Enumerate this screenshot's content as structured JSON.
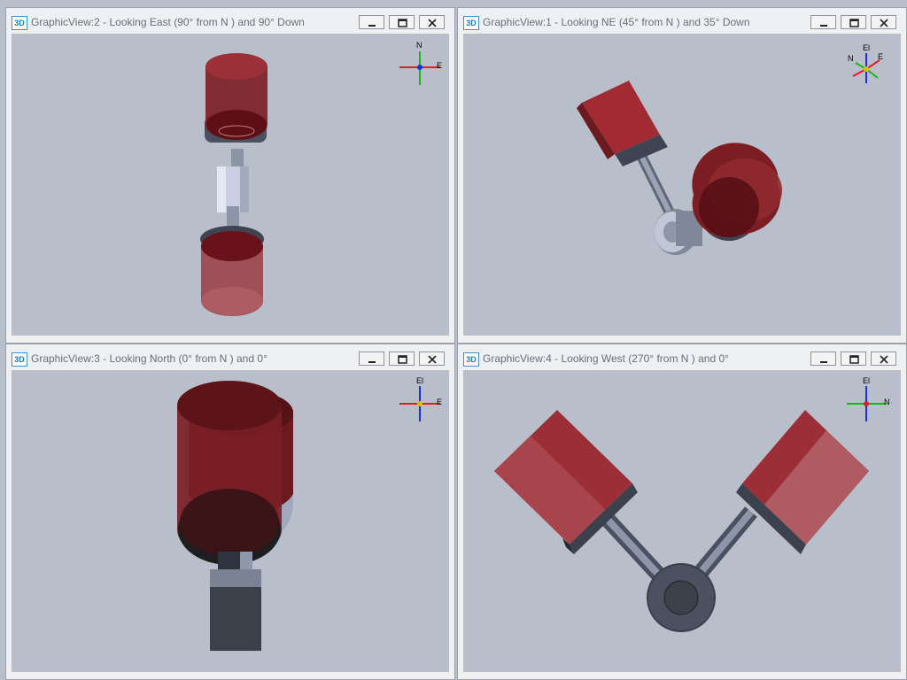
{
  "colors": {
    "background": "#b9bfca",
    "piston_red": "#8a1f26",
    "metal": "#9aa3b4",
    "axis_x": "#e02020",
    "axis_y": "#1ab51a",
    "axis_z": "#1f2fd6"
  },
  "windows": [
    {
      "title": "GraphicView:2 - Looking East (90° from N ) and 90° Down",
      "icon": "3D",
      "triad": [
        "N",
        "E"
      ]
    },
    {
      "title": "GraphicView:1 - Looking NE (45° from N ) and 35° Down",
      "icon": "3D",
      "triad": [
        "El",
        "N",
        "E"
      ]
    },
    {
      "title": "GraphicView:3 - Looking North (0° from N ) and 0°",
      "icon": "3D",
      "triad": [
        "El",
        "E"
      ]
    },
    {
      "title": "GraphicView:4 - Looking West (270° from N ) and 0°",
      "icon": "3D",
      "triad": [
        "El",
        "N"
      ]
    }
  ]
}
